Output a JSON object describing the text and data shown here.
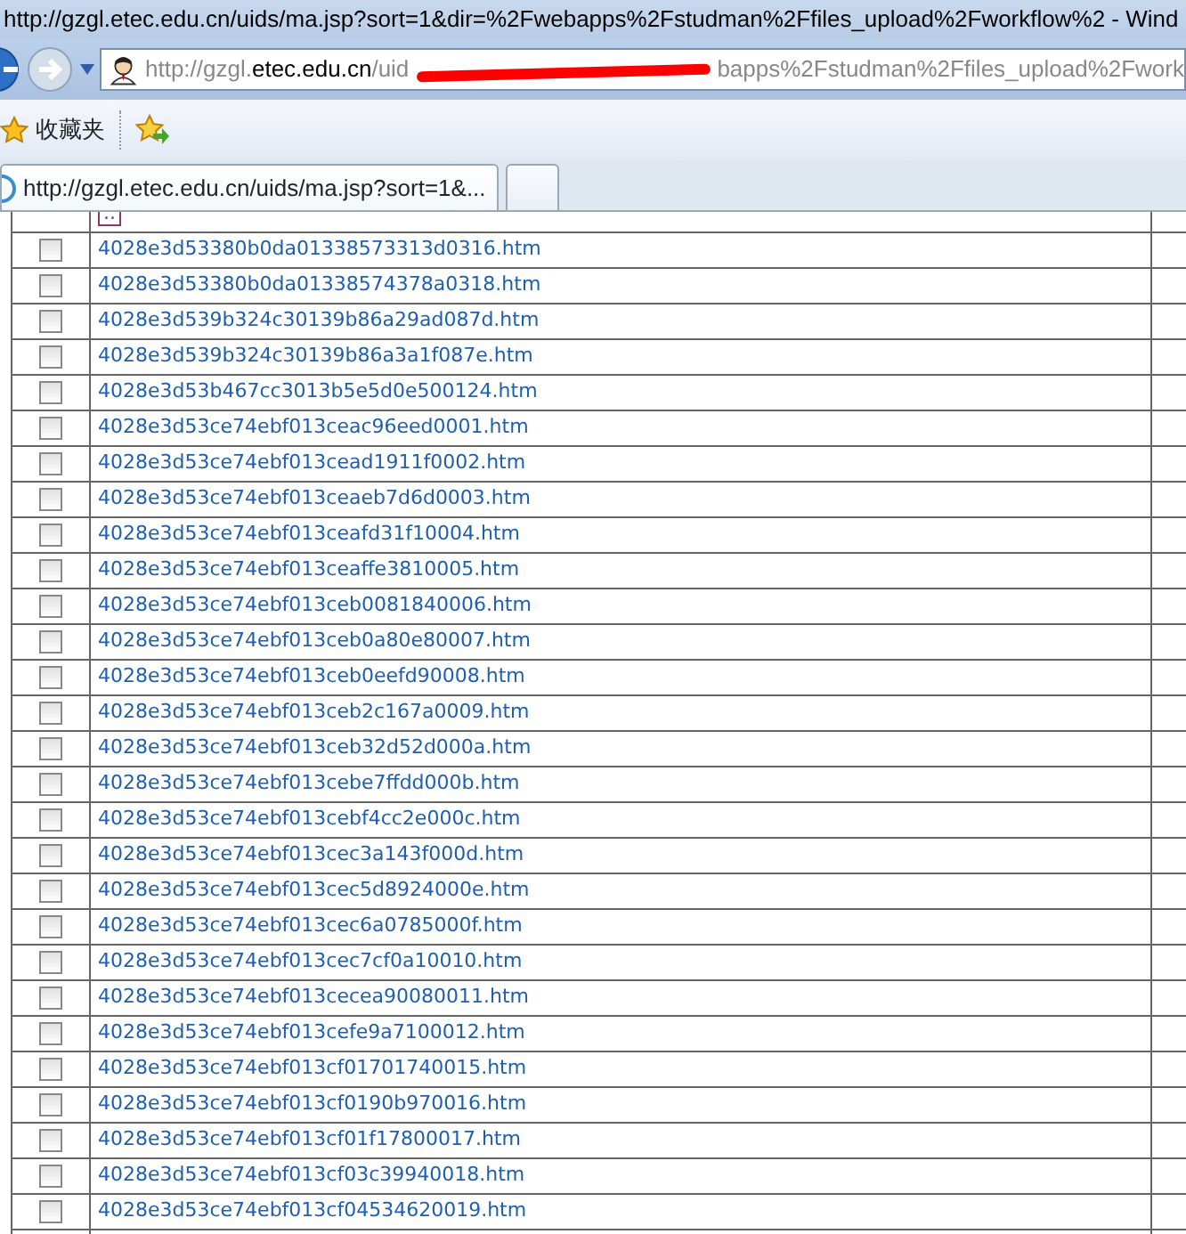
{
  "window": {
    "title": "http://gzgl.etec.edu.cn/uids/ma.jsp?sort=1&dir=%2Fwebapps%2Fstudman%2Ffiles_upload%2Fworkflow%2 - Wind"
  },
  "address_bar": {
    "host_prefix": "http://gzgl.",
    "host": "etec.edu.cn",
    "path_start": "/uid",
    "path_end": "bapps%2Fstudman%2Ffiles_upload%2Fwork",
    "redacted": true
  },
  "favorites_bar": {
    "label": "收藏夹"
  },
  "tabs": [
    {
      "label": "http://gzgl.etec.edu.cn/uids/ma.jsp?sort=1&...",
      "selected": true
    }
  ],
  "parent_link": "..",
  "files": [
    {
      "name": "4028e3d53380b0da01338573313d0316.htm",
      "checked": false
    },
    {
      "name": "4028e3d53380b0da01338574378a0318.htm",
      "checked": false
    },
    {
      "name": "4028e3d539b324c30139b86a29ad087d.htm",
      "checked": false
    },
    {
      "name": "4028e3d539b324c30139b86a3a1f087e.htm",
      "checked": false
    },
    {
      "name": "4028e3d53b467cc3013b5e5d0e500124.htm",
      "checked": false
    },
    {
      "name": "4028e3d53ce74ebf013ceac96eed0001.htm",
      "checked": false
    },
    {
      "name": "4028e3d53ce74ebf013cead1911f0002.htm",
      "checked": false
    },
    {
      "name": "4028e3d53ce74ebf013ceaeb7d6d0003.htm",
      "checked": false
    },
    {
      "name": "4028e3d53ce74ebf013ceafd31f10004.htm",
      "checked": false
    },
    {
      "name": "4028e3d53ce74ebf013ceaffe3810005.htm",
      "checked": false
    },
    {
      "name": "4028e3d53ce74ebf013ceb0081840006.htm",
      "checked": false
    },
    {
      "name": "4028e3d53ce74ebf013ceb0a80e80007.htm",
      "checked": false
    },
    {
      "name": "4028e3d53ce74ebf013ceb0eefd90008.htm",
      "checked": false
    },
    {
      "name": "4028e3d53ce74ebf013ceb2c167a0009.htm",
      "checked": false
    },
    {
      "name": "4028e3d53ce74ebf013ceb32d52d000a.htm",
      "checked": false
    },
    {
      "name": "4028e3d53ce74ebf013cebe7ffdd000b.htm",
      "checked": false
    },
    {
      "name": "4028e3d53ce74ebf013cebf4cc2e000c.htm",
      "checked": false
    },
    {
      "name": "4028e3d53ce74ebf013cec3a143f000d.htm",
      "checked": false
    },
    {
      "name": "4028e3d53ce74ebf013cec5d8924000e.htm",
      "checked": false
    },
    {
      "name": "4028e3d53ce74ebf013cec6a0785000f.htm",
      "checked": false
    },
    {
      "name": "4028e3d53ce74ebf013cec7cf0a10010.htm",
      "checked": false
    },
    {
      "name": "4028e3d53ce74ebf013cecea90080011.htm",
      "checked": false
    },
    {
      "name": "4028e3d53ce74ebf013cefe9a7100012.htm",
      "checked": false
    },
    {
      "name": "4028e3d53ce74ebf013cf01701740015.htm",
      "checked": false
    },
    {
      "name": "4028e3d53ce74ebf013cf0190b970016.htm",
      "checked": false
    },
    {
      "name": "4028e3d53ce74ebf013cf01f17800017.htm",
      "checked": false
    },
    {
      "name": "4028e3d53ce74ebf013cf03c39940018.htm",
      "checked": false
    },
    {
      "name": "4028e3d53ce74ebf013cf04534620019.htm",
      "checked": false
    }
  ]
}
